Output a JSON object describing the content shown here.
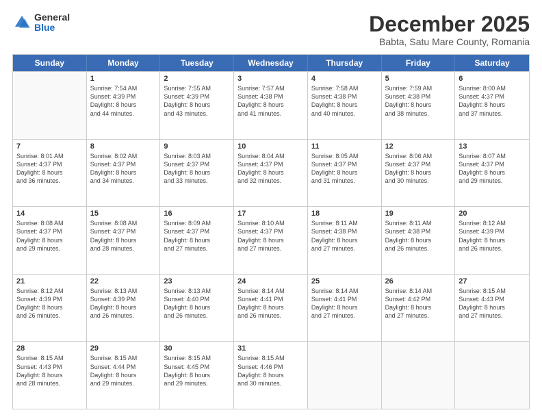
{
  "header": {
    "logo_general": "General",
    "logo_blue": "Blue",
    "main_title": "December 2025",
    "subtitle": "Babta, Satu Mare County, Romania"
  },
  "calendar": {
    "days_of_week": [
      "Sunday",
      "Monday",
      "Tuesday",
      "Wednesday",
      "Thursday",
      "Friday",
      "Saturday"
    ],
    "weeks": [
      [
        {
          "day": null,
          "info": null
        },
        {
          "day": "1",
          "info": "Sunrise: 7:54 AM\nSunset: 4:39 PM\nDaylight: 8 hours\nand 44 minutes."
        },
        {
          "day": "2",
          "info": "Sunrise: 7:55 AM\nSunset: 4:39 PM\nDaylight: 8 hours\nand 43 minutes."
        },
        {
          "day": "3",
          "info": "Sunrise: 7:57 AM\nSunset: 4:38 PM\nDaylight: 8 hours\nand 41 minutes."
        },
        {
          "day": "4",
          "info": "Sunrise: 7:58 AM\nSunset: 4:38 PM\nDaylight: 8 hours\nand 40 minutes."
        },
        {
          "day": "5",
          "info": "Sunrise: 7:59 AM\nSunset: 4:38 PM\nDaylight: 8 hours\nand 38 minutes."
        },
        {
          "day": "6",
          "info": "Sunrise: 8:00 AM\nSunset: 4:37 PM\nDaylight: 8 hours\nand 37 minutes."
        }
      ],
      [
        {
          "day": "7",
          "info": "Sunrise: 8:01 AM\nSunset: 4:37 PM\nDaylight: 8 hours\nand 36 minutes."
        },
        {
          "day": "8",
          "info": "Sunrise: 8:02 AM\nSunset: 4:37 PM\nDaylight: 8 hours\nand 34 minutes."
        },
        {
          "day": "9",
          "info": "Sunrise: 8:03 AM\nSunset: 4:37 PM\nDaylight: 8 hours\nand 33 minutes."
        },
        {
          "day": "10",
          "info": "Sunrise: 8:04 AM\nSunset: 4:37 PM\nDaylight: 8 hours\nand 32 minutes."
        },
        {
          "day": "11",
          "info": "Sunrise: 8:05 AM\nSunset: 4:37 PM\nDaylight: 8 hours\nand 31 minutes."
        },
        {
          "day": "12",
          "info": "Sunrise: 8:06 AM\nSunset: 4:37 PM\nDaylight: 8 hours\nand 30 minutes."
        },
        {
          "day": "13",
          "info": "Sunrise: 8:07 AM\nSunset: 4:37 PM\nDaylight: 8 hours\nand 29 minutes."
        }
      ],
      [
        {
          "day": "14",
          "info": "Sunrise: 8:08 AM\nSunset: 4:37 PM\nDaylight: 8 hours\nand 29 minutes."
        },
        {
          "day": "15",
          "info": "Sunrise: 8:08 AM\nSunset: 4:37 PM\nDaylight: 8 hours\nand 28 minutes."
        },
        {
          "day": "16",
          "info": "Sunrise: 8:09 AM\nSunset: 4:37 PM\nDaylight: 8 hours\nand 27 minutes."
        },
        {
          "day": "17",
          "info": "Sunrise: 8:10 AM\nSunset: 4:37 PM\nDaylight: 8 hours\nand 27 minutes."
        },
        {
          "day": "18",
          "info": "Sunrise: 8:11 AM\nSunset: 4:38 PM\nDaylight: 8 hours\nand 27 minutes."
        },
        {
          "day": "19",
          "info": "Sunrise: 8:11 AM\nSunset: 4:38 PM\nDaylight: 8 hours\nand 26 minutes."
        },
        {
          "day": "20",
          "info": "Sunrise: 8:12 AM\nSunset: 4:39 PM\nDaylight: 8 hours\nand 26 minutes."
        }
      ],
      [
        {
          "day": "21",
          "info": "Sunrise: 8:12 AM\nSunset: 4:39 PM\nDaylight: 8 hours\nand 26 minutes."
        },
        {
          "day": "22",
          "info": "Sunrise: 8:13 AM\nSunset: 4:39 PM\nDaylight: 8 hours\nand 26 minutes."
        },
        {
          "day": "23",
          "info": "Sunrise: 8:13 AM\nSunset: 4:40 PM\nDaylight: 8 hours\nand 26 minutes."
        },
        {
          "day": "24",
          "info": "Sunrise: 8:14 AM\nSunset: 4:41 PM\nDaylight: 8 hours\nand 26 minutes."
        },
        {
          "day": "25",
          "info": "Sunrise: 8:14 AM\nSunset: 4:41 PM\nDaylight: 8 hours\nand 27 minutes."
        },
        {
          "day": "26",
          "info": "Sunrise: 8:14 AM\nSunset: 4:42 PM\nDaylight: 8 hours\nand 27 minutes."
        },
        {
          "day": "27",
          "info": "Sunrise: 8:15 AM\nSunset: 4:43 PM\nDaylight: 8 hours\nand 27 minutes."
        }
      ],
      [
        {
          "day": "28",
          "info": "Sunrise: 8:15 AM\nSunset: 4:43 PM\nDaylight: 8 hours\nand 28 minutes."
        },
        {
          "day": "29",
          "info": "Sunrise: 8:15 AM\nSunset: 4:44 PM\nDaylight: 8 hours\nand 29 minutes."
        },
        {
          "day": "30",
          "info": "Sunrise: 8:15 AM\nSunset: 4:45 PM\nDaylight: 8 hours\nand 29 minutes."
        },
        {
          "day": "31",
          "info": "Sunrise: 8:15 AM\nSunset: 4:46 PM\nDaylight: 8 hours\nand 30 minutes."
        },
        {
          "day": null,
          "info": null
        },
        {
          "day": null,
          "info": null
        },
        {
          "day": null,
          "info": null
        }
      ]
    ]
  }
}
